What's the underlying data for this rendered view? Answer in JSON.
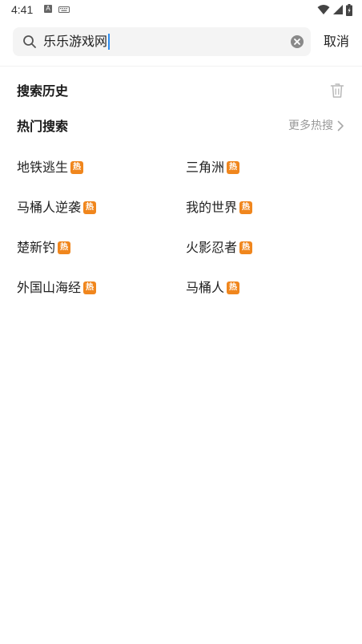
{
  "status_bar": {
    "time": "4:41",
    "a_icon_letter": "A"
  },
  "search": {
    "value": "乐乐游戏网",
    "cancel_label": "取消"
  },
  "history": {
    "title": "搜索历史"
  },
  "hot": {
    "title": "热门搜索",
    "more_label": "更多热搜",
    "badge_label": "热",
    "badge_color": "#f0861d",
    "items": [
      {
        "label": "地铁逃生"
      },
      {
        "label": "三角洲"
      },
      {
        "label": "马桶人逆袭"
      },
      {
        "label": "我的世界"
      },
      {
        "label": "楚新钓"
      },
      {
        "label": "火影忍者"
      },
      {
        "label": "外国山海经"
      },
      {
        "label": "马桶人"
      }
    ]
  },
  "icons": {
    "search": "search-icon",
    "clear": "clear-icon",
    "trash": "trash-icon",
    "chevron": "chevron-right-icon",
    "wifi": "wifi-icon",
    "signal": "signal-icon",
    "battery": "battery-icon",
    "keyboard": "keyboard-icon"
  }
}
